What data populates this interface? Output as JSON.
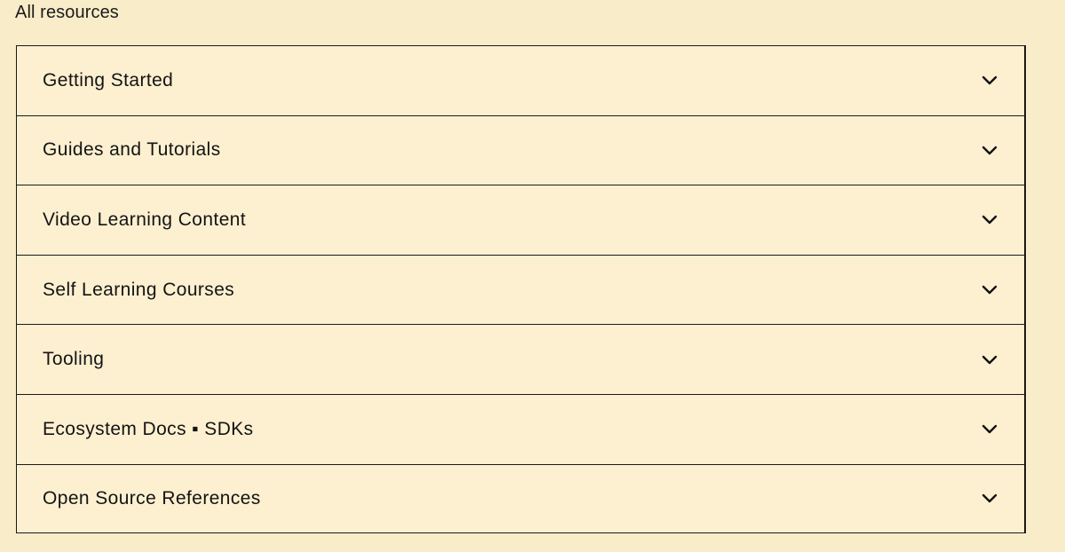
{
  "header": {
    "title": "All resources"
  },
  "accordion": {
    "items": [
      {
        "label": "Getting Started",
        "icon": "chevron-down-icon",
        "expanded": false
      },
      {
        "label": "Guides and Tutorials",
        "icon": "chevron-down-icon",
        "expanded": false
      },
      {
        "label": "Video Learning Content",
        "icon": "chevron-down-icon",
        "expanded": false
      },
      {
        "label": "Self Learning Courses",
        "icon": "chevron-down-icon",
        "expanded": false
      },
      {
        "label": "Tooling",
        "icon": "chevron-down-icon",
        "expanded": false
      },
      {
        "label": "Ecosystem Docs ▪ SDKs",
        "icon": "chevron-down-icon",
        "expanded": false
      },
      {
        "label": "Open Source References",
        "icon": "chevron-down-icon",
        "expanded": false
      }
    ]
  },
  "colors": {
    "background": "#f8ecc9",
    "panel": "#fdf0d0",
    "border": "#1a1a1a",
    "text": "#141414"
  }
}
